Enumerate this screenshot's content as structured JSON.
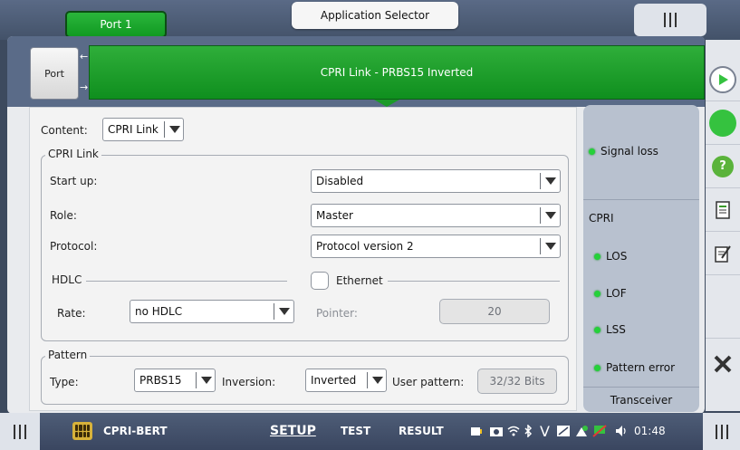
{
  "top": {
    "port_tab": "Port 1",
    "app_selector": "Application Selector"
  },
  "banner": {
    "port_button": "Port",
    "status": "CPRI Link - PRBS15 Inverted"
  },
  "content": {
    "label": "Content:",
    "value": "CPRI Link"
  },
  "cpri_link": {
    "title": "CPRI Link",
    "startup_label": "Start up:",
    "startup_value": "Disabled",
    "role_label": "Role:",
    "role_value": "Master",
    "protocol_label": "Protocol:",
    "protocol_value": "Protocol version 2",
    "hdlc_title": "HDLC",
    "rate_label": "Rate:",
    "rate_value": "no HDLC",
    "ethernet_label": "Ethernet",
    "ethernet_checked": false,
    "pointer_label": "Pointer:",
    "pointer_value": "20"
  },
  "pattern": {
    "title": "Pattern",
    "type_label": "Type:",
    "type_value": "PRBS15",
    "inversion_label": "Inversion:",
    "inversion_value": "Inverted",
    "user_pattern_label": "User pattern:",
    "user_pattern_value": "32/32 Bits"
  },
  "signal": {
    "signal_loss": "Signal loss",
    "cpri_heading": "CPRI",
    "los": "LOS",
    "lof": "LOF",
    "lss": "LSS",
    "pattern_error": "Pattern error",
    "transceiver": "Transceiver",
    "led_color": "#25d13a"
  },
  "right_toolbar": {
    "icons": [
      "play-icon",
      "status-led-icon",
      "help-icon",
      "report-icon",
      "edit-icon",
      "close-icon"
    ],
    "accent": "#35c23f"
  },
  "bottom": {
    "app_name": "CPRI-BERT",
    "tab_setup": "SETUP",
    "tab_test": "TEST",
    "tab_result": "RESULT",
    "time": "01:48",
    "status_glyph": "V"
  }
}
